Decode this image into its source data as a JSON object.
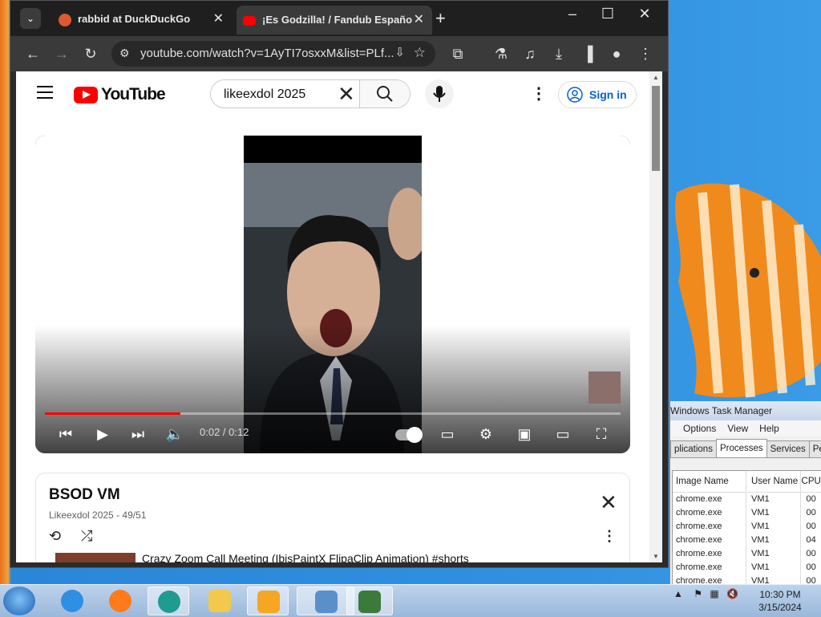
{
  "browser": {
    "tabs": [
      {
        "title": "rabbid at DuckDuckGo",
        "favicon": "duckduckgo-icon",
        "color": "#de5833"
      },
      {
        "title": "¡Es Godzilla! / Fandub Españo",
        "favicon": "youtube-icon",
        "color": "#ff0000"
      }
    ],
    "url": "youtube.com/watch?v=1AyTI7osxxM&list=PLf..."
  },
  "youtube": {
    "logo_text": "YouTube",
    "search_value": "likeexdol 2025",
    "sign_in": "Sign in",
    "player": {
      "time": "0:02 / 0:12",
      "progress_fraction": 0.235
    },
    "playlist": {
      "title": "BSOD VM",
      "subtitle": "Likeexdol 2025 - 49/51",
      "next_item": "Crazy Zoom Call Meeting (IbisPaintX FlipaClip Animation) #shorts"
    }
  },
  "task_manager": {
    "title": "Windows Task Manager",
    "menu": [
      "Options",
      "View",
      "Help"
    ],
    "tabs": [
      "plications",
      "Processes",
      "Services",
      "Perf"
    ],
    "active_tab": "Processes",
    "columns": [
      "Image Name",
      "User Name",
      "CPU"
    ],
    "rows": [
      {
        "name": "chrome.exe",
        "user": "VM1",
        "cpu": "00"
      },
      {
        "name": "chrome.exe",
        "user": "VM1",
        "cpu": "00"
      },
      {
        "name": "chrome.exe",
        "user": "VM1",
        "cpu": "00"
      },
      {
        "name": "chrome.exe",
        "user": "VM1",
        "cpu": "04"
      },
      {
        "name": "chrome.exe",
        "user": "VM1",
        "cpu": "00"
      },
      {
        "name": "chrome.exe",
        "user": "VM1",
        "cpu": "00"
      },
      {
        "name": "chrome.exe",
        "user": "VM1",
        "cpu": "00"
      }
    ]
  },
  "taskbar": {
    "time": "10:30 PM",
    "date": "3/15/2024"
  }
}
